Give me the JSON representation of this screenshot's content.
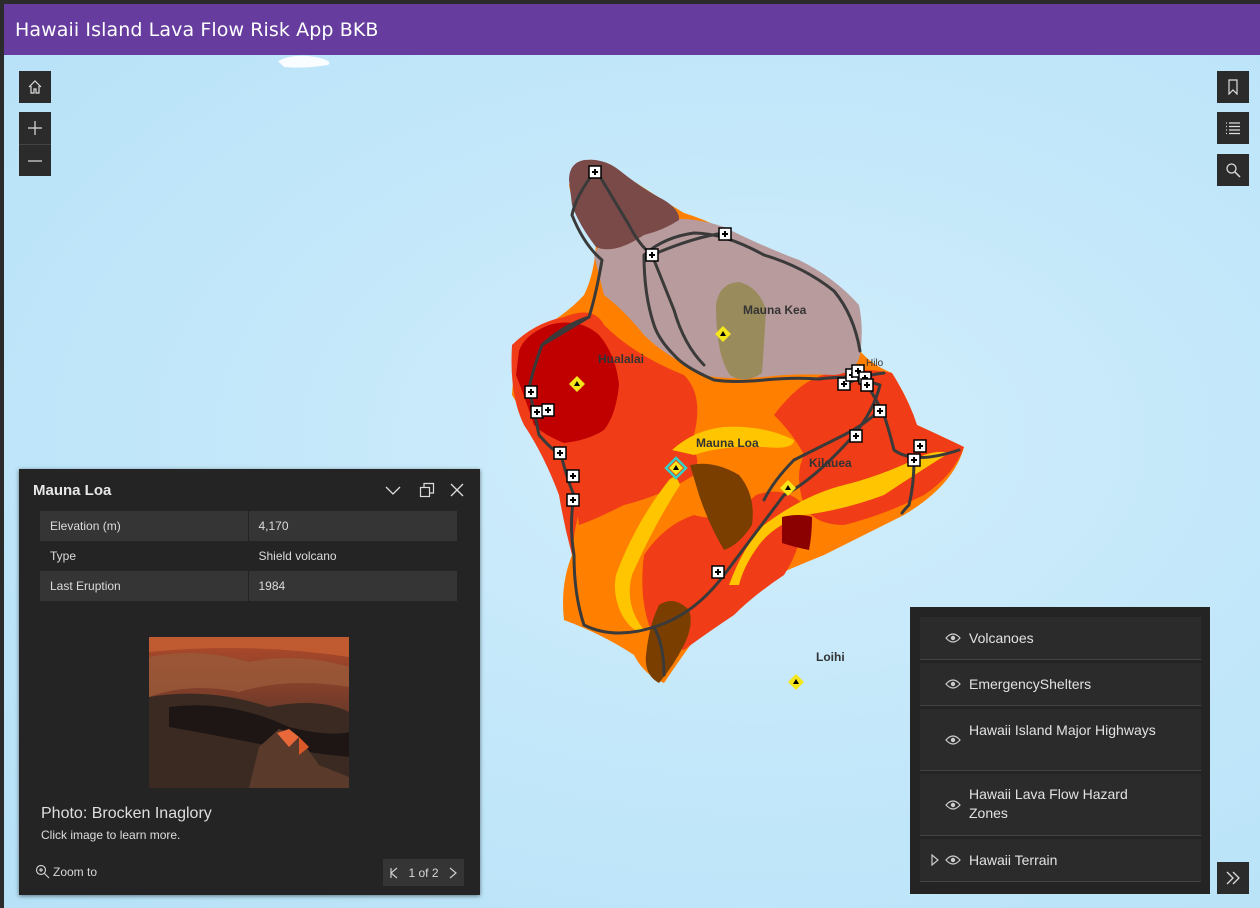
{
  "app": {
    "title": "Hawaii Island Lava Flow Risk App BKB"
  },
  "map_labels": {
    "mauna_kea": "Mauna Kea",
    "hualalai": "Hualalai",
    "mauna_loa": "Mauna Loa",
    "kilauea": "Kilauea",
    "loihi": "Loihi",
    "hilo": "Hilo"
  },
  "popup": {
    "title": "Mauna Loa",
    "attributes": [
      {
        "key": "Elevation (m)",
        "value": "4,170"
      },
      {
        "key": "Type",
        "value": "Shield volcano"
      },
      {
        "key": "Last Eruption",
        "value": "1984"
      }
    ],
    "photo_caption": "Photo: Brocken Inaglory",
    "photo_hint": "Click image to learn more.",
    "zoom_to": "Zoom to",
    "pager": "1 of 2"
  },
  "layers": [
    {
      "name": "Volcanoes",
      "icon": "eye-icon"
    },
    {
      "name": "EmergencyShelters",
      "icon": "eye-icon"
    },
    {
      "name": "Hawaii Island Major Highways",
      "icon": "eye-icon"
    },
    {
      "name": "Hawaii Lava Flow Hazard Zones",
      "icon": "eye-icon"
    },
    {
      "name": "Hawaii Terrain",
      "icon": "eye-icon"
    }
  ],
  "colors": {
    "header": "#663d9e",
    "zone_high": "#c00000",
    "zone_red": "#f03c17",
    "zone_orange": "#ff8000",
    "zone_yellow": "#ffc500",
    "zone_brown": "#7a3f00",
    "zone_dark_brown": "#7a4a48",
    "zone_mauve": "#b89b9c",
    "zone_olive": "#9a8b5c",
    "ocean": "#c4e8fa"
  }
}
